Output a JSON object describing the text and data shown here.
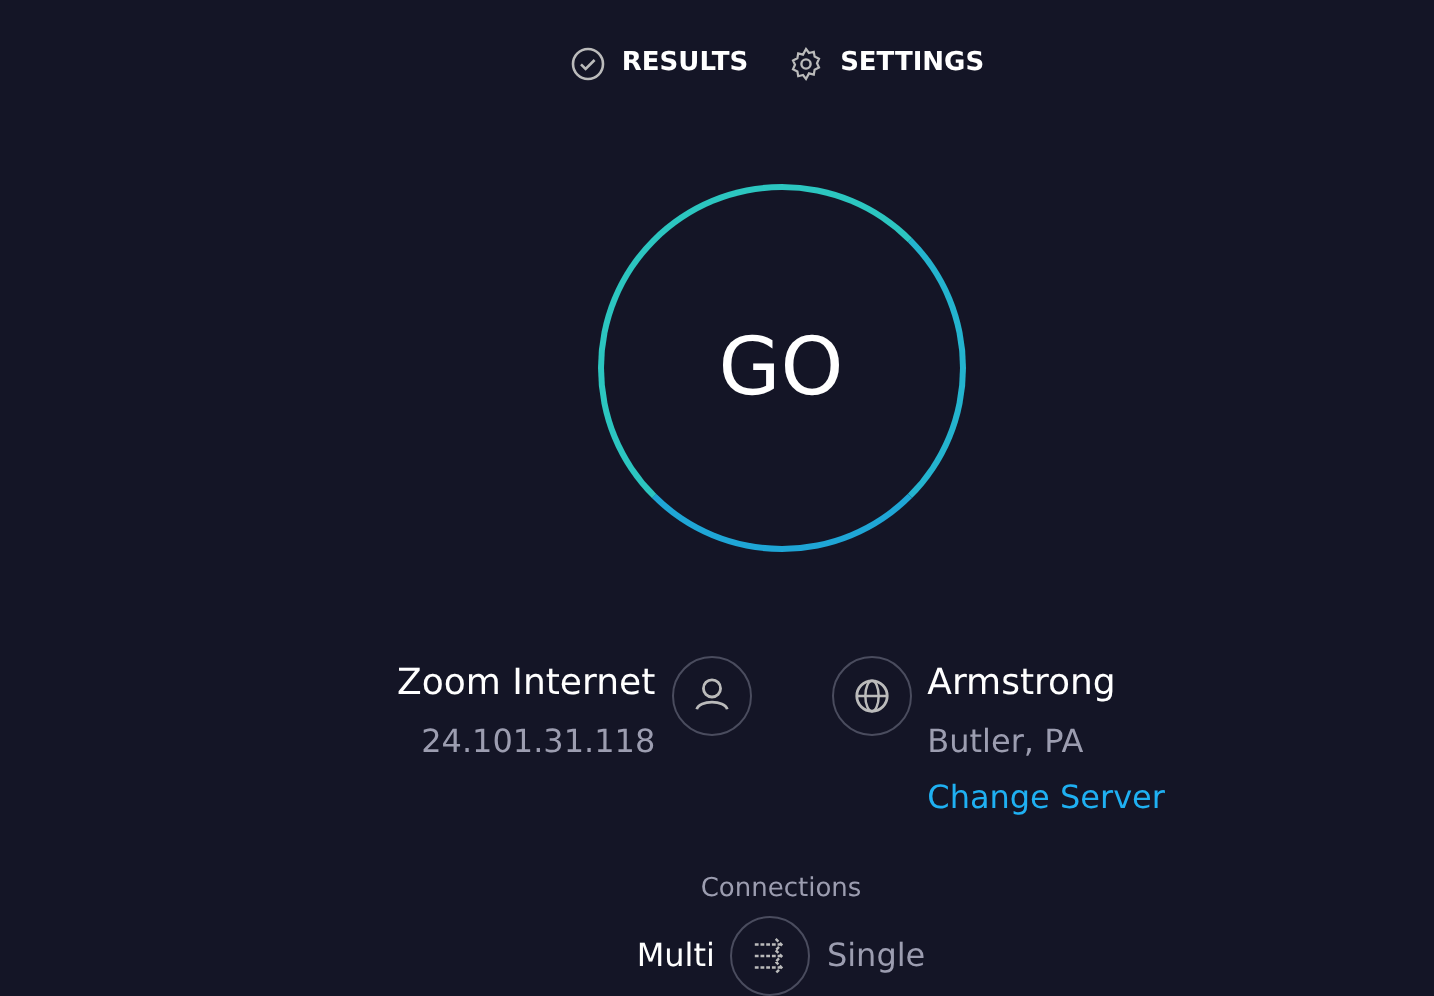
{
  "nav": [
    {
      "label": "RESULTS"
    },
    {
      "label": "SETTINGS"
    }
  ],
  "go_button": {
    "label": "GO"
  },
  "provider": {
    "name": "Zoom Internet",
    "ip": "24.101.31.118"
  },
  "server": {
    "name": "Armstrong",
    "location": "Butler, PA",
    "link": "Change Server"
  },
  "connections": {
    "label": "Connections",
    "options": [
      {
        "label": "Multi",
        "selected": true
      },
      {
        "label": "Single",
        "selected": false
      }
    ]
  }
}
